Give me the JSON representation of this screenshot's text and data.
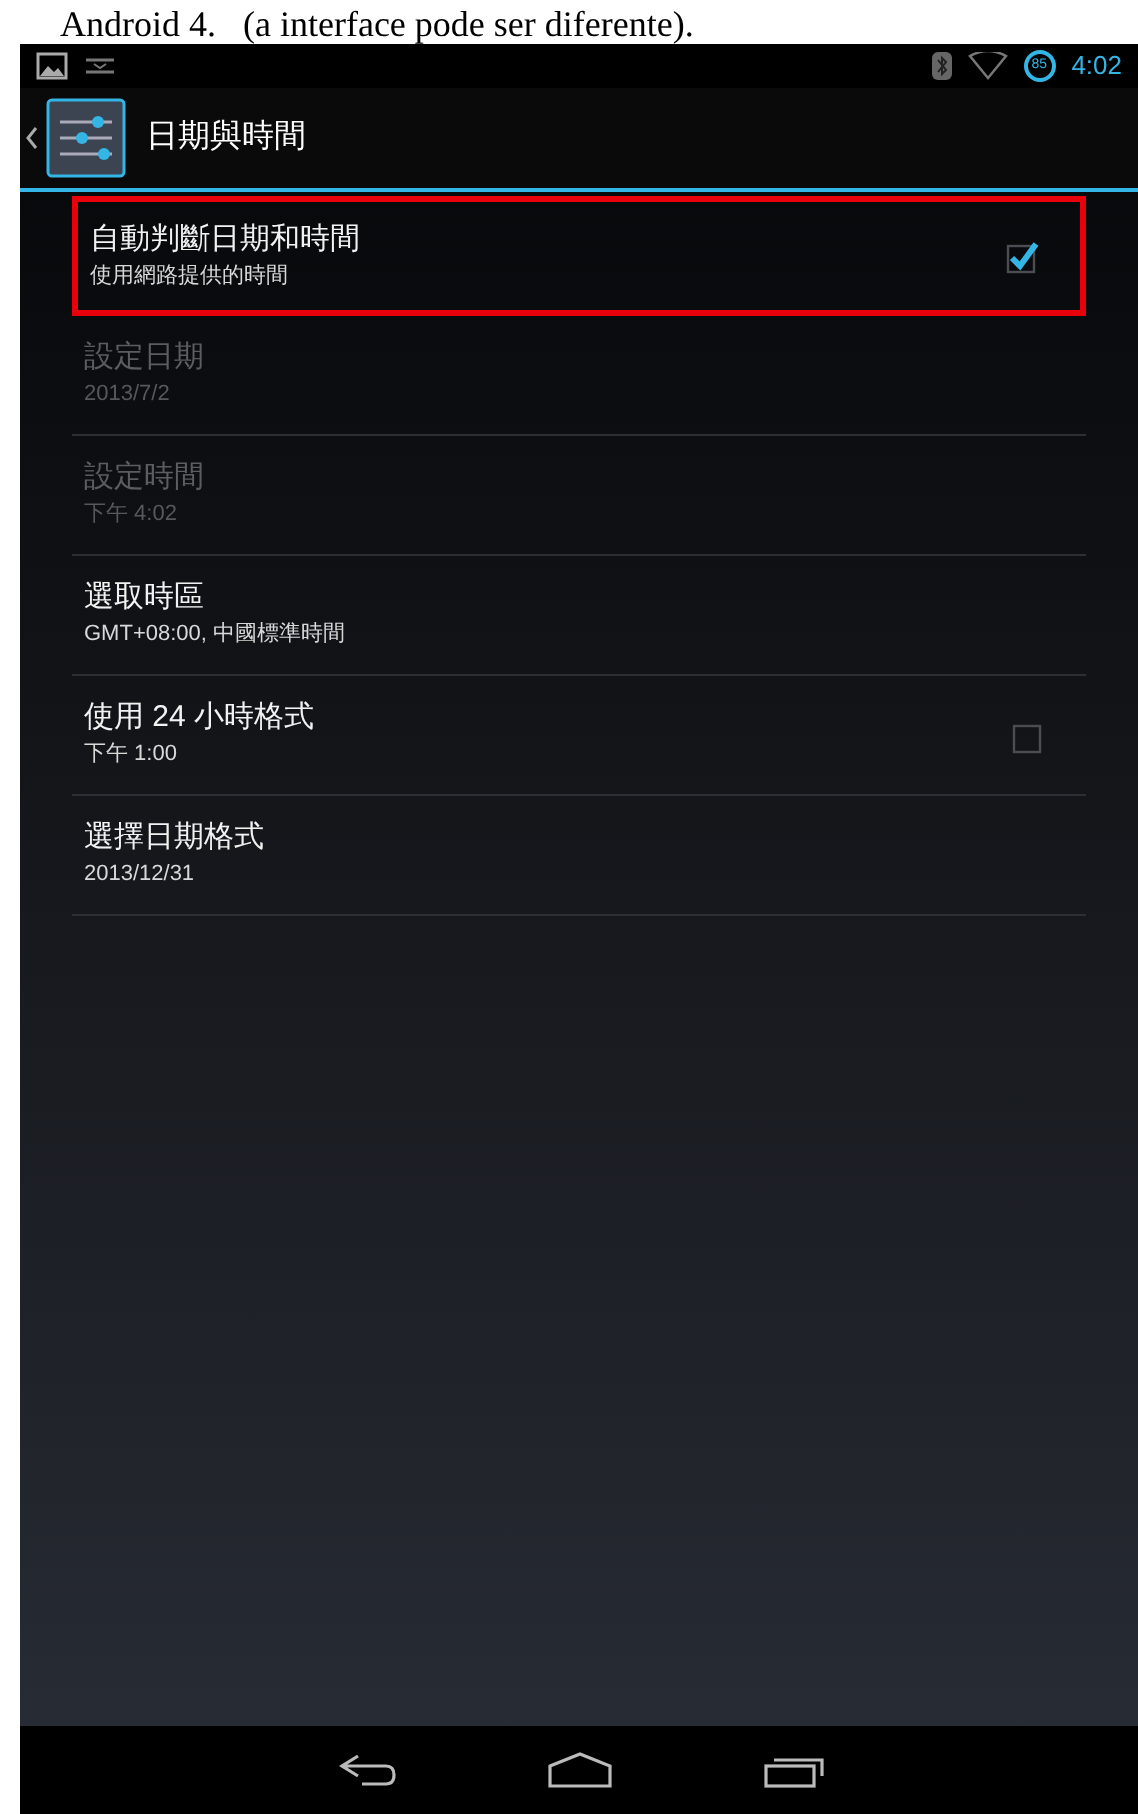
{
  "caption": "Android 4.   (a interface pode ser diferente).",
  "status_bar": {
    "battery": "85",
    "time": "4:02"
  },
  "action_bar": {
    "title": "日期與時間"
  },
  "settings": [
    {
      "kind": "checkbox",
      "title": "自動判斷日期和時間",
      "summary": "使用網路提供的時間",
      "checked": true,
      "disabled": false,
      "highlighted": true
    },
    {
      "kind": "plain",
      "title": "設定日期",
      "summary": "2013/7/2",
      "disabled": true,
      "highlighted": false
    },
    {
      "kind": "plain",
      "title": "設定時間",
      "summary": "下午 4:02",
      "disabled": true,
      "highlighted": false
    },
    {
      "kind": "plain",
      "title": "選取時區",
      "summary": "GMT+08:00, 中國標準時間",
      "disabled": false,
      "highlighted": false
    },
    {
      "kind": "checkbox",
      "title": "使用 24 小時格式",
      "summary": "下午 1:00",
      "checked": false,
      "disabled": false,
      "highlighted": false
    },
    {
      "kind": "plain",
      "title": "選擇日期格式",
      "summary": "2013/12/31",
      "disabled": false,
      "highlighted": false
    }
  ]
}
